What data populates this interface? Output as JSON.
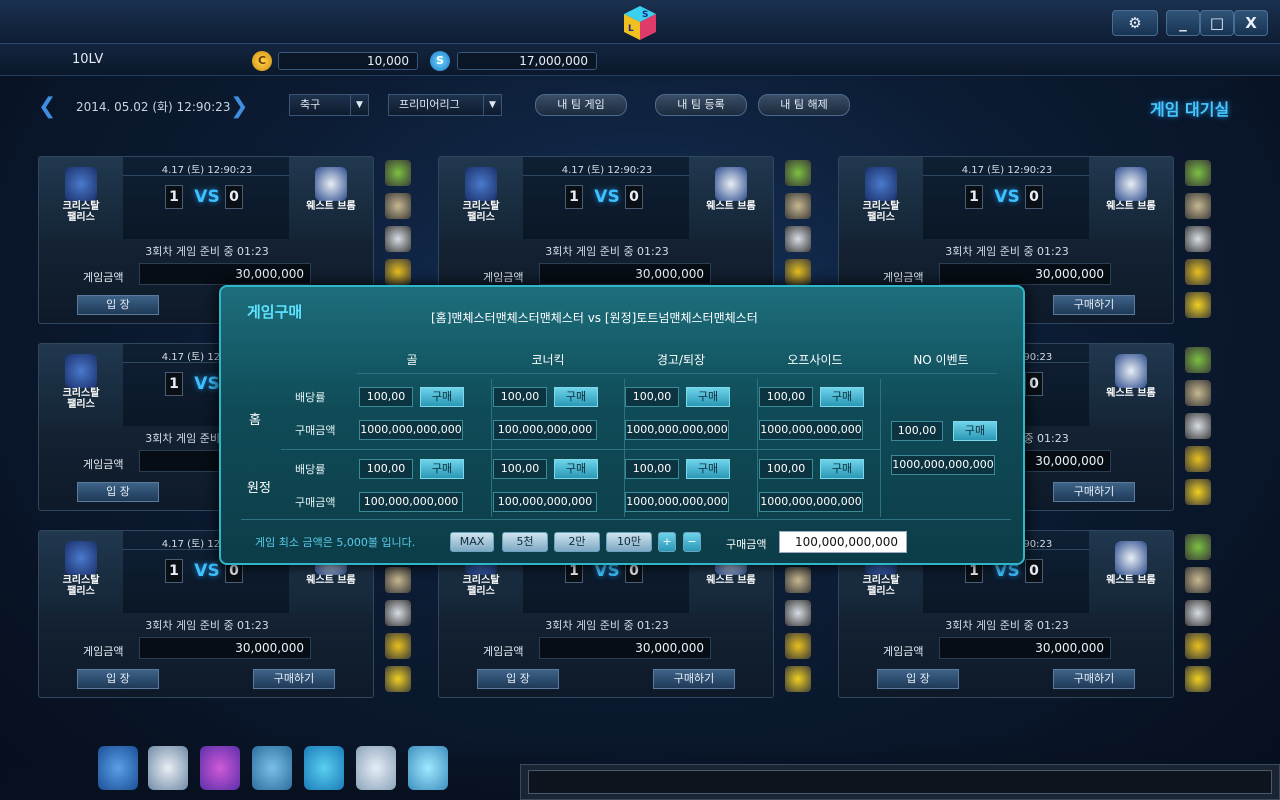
{
  "app": {
    "logo_icon": "sl-cube-logo-icon"
  },
  "window_controls": {
    "settings": "⚙",
    "minimize": "_",
    "maximize": "□",
    "close": "X"
  },
  "status": {
    "level": "10LV",
    "coin_label": "C",
    "coin_value": "10,000",
    "star_label": "S",
    "star_value": "17,000,000"
  },
  "toolbar": {
    "prev": "❮",
    "next": "❯",
    "datetime": "2014. 05.02 (화)  12:90:23",
    "sport_select": "축구",
    "league_select": "프리미어리그",
    "my_team_game": "내 팀 게임",
    "my_team_register": "내 팀 등록",
    "my_team_remove": "내 팀 해제",
    "lobby_title": "게임 대기실"
  },
  "match_common": {
    "date": "4.17 (토)  12:90:23",
    "home_name_1": "크리스탈",
    "home_name_2": "팰리스",
    "away_name": "웨스트 브롬",
    "home_score": "1",
    "vs": "VS",
    "away_score": "0",
    "round_status": "3회차  게임 준비 중    01:23",
    "amount_label": "게임금액",
    "amount": "30,000,000",
    "enter_button": "입  장",
    "buy_button": "구매하기"
  },
  "modal": {
    "title": "게임구매",
    "match_title": "[홈]맨체스터맨체스터맨체스터 vs [원정]토트넘맨체스터맨체스터",
    "columns": [
      "골",
      "코너킥",
      "경고/퇴장",
      "오프사이드",
      "NO 이벤트"
    ],
    "row_home": "홈",
    "row_away": "원정",
    "odds_label": "배당률",
    "amount_label": "구매금액",
    "buy_label": "구매",
    "home_odds": [
      "100,00",
      "100,00",
      "100,00",
      "100,00"
    ],
    "home_amounts": [
      "1000,000,000,000",
      "100,000,000,000",
      "1000,000,000,000",
      "1000,000,000,000"
    ],
    "away_odds": [
      "100,00",
      "100,00",
      "100,00",
      "100,00"
    ],
    "away_amounts": [
      "100,000,000,000",
      "100,000,000,000",
      "1000,000,000,000",
      "1000,000,000,000"
    ],
    "noevent_odds": "100,00",
    "noevent_amount": "1000,000,000,000",
    "min_notice": "게임 최소 금액은 5,000볼 입니다.",
    "btn_max": "MAX",
    "btn_5k": "5천",
    "btn_20k": "2만",
    "btn_100k": "10만",
    "btn_plus": "+",
    "btn_minus": "−",
    "purchase_label": "구매금액",
    "purchase_amount": "100,000,000,000"
  },
  "colors": {
    "accent": "#47c8ff",
    "modal_border": "#2fb6c9",
    "buy_button": "#6ed3ea"
  }
}
